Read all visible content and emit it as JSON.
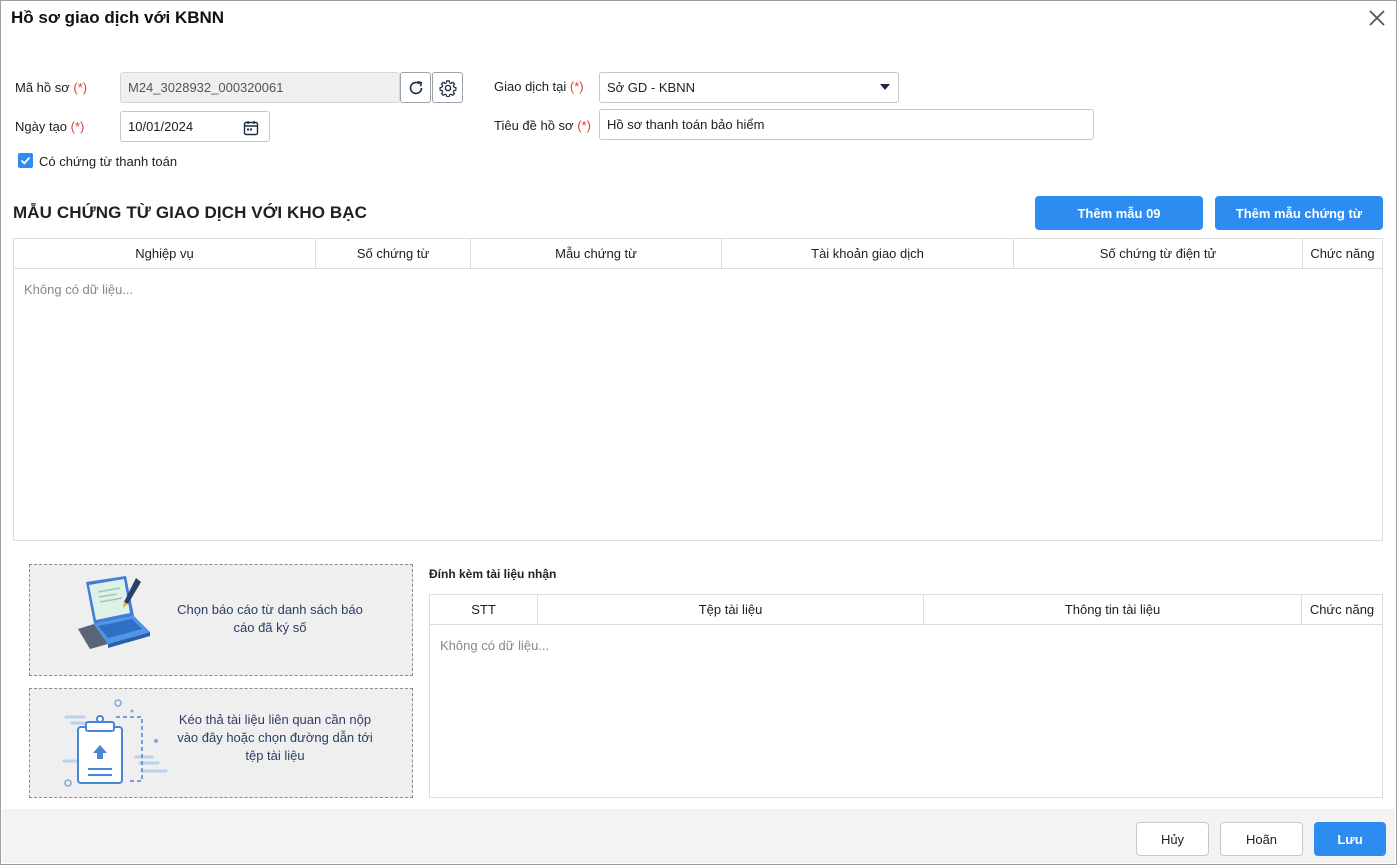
{
  "dialog": {
    "title": "Hồ sơ giao dịch với KBNN"
  },
  "form": {
    "ma_ho_so": {
      "label": "Mã hồ sơ",
      "required_mark": "(*)",
      "value": "M24_3028932_000320061"
    },
    "ngay_tao": {
      "label": "Ngày tạo",
      "required_mark": "(*)",
      "value": "10/01/2024"
    },
    "giao_dich_tai": {
      "label": "Giao dịch tại",
      "required_mark": "(*)",
      "value": "Sở GD - KBNN"
    },
    "tieu_de": {
      "label": "Tiêu đề hồ sơ",
      "required_mark": "(*)",
      "value": "Hồ sơ thanh toán bảo hiểm"
    },
    "co_chung_tu": {
      "label": "Có chứng từ thanh toán",
      "checked": true
    }
  },
  "voucher_section": {
    "title": "MẪU CHỨNG TỪ GIAO DỊCH VỚI KHO BẠC",
    "add_09_label": "Thêm mẫu 09",
    "add_template_label": "Thêm mẫu chứng từ",
    "columns": [
      "Nghiệp vụ",
      "Số chứng từ",
      "Mẫu chứng từ",
      "Tài khoản giao dịch",
      "Số chứng từ điện tử",
      "Chức năng"
    ],
    "empty_text": "Không có dữ liệu..."
  },
  "upload": {
    "choose_report_text": "Chọn báo cáo từ danh sách báo cáo đã ký số",
    "drag_drop_text": "Kéo thả tài liệu liên quan cần nộp vào đây hoặc chọn đường dẫn tới tệp tài liệu"
  },
  "attachments": {
    "title": "Đính kèm tài liệu nhận",
    "columns": [
      "STT",
      "Tệp tài liệu",
      "Thông tin tài liệu",
      "Chức năng"
    ],
    "empty_text": "Không có dữ liệu..."
  },
  "footer": {
    "cancel_label": "Hủy",
    "defer_label": "Hoãn",
    "save_label": "Lưu"
  },
  "colors": {
    "primary": "#2d8cf0",
    "required": "#e53935"
  }
}
